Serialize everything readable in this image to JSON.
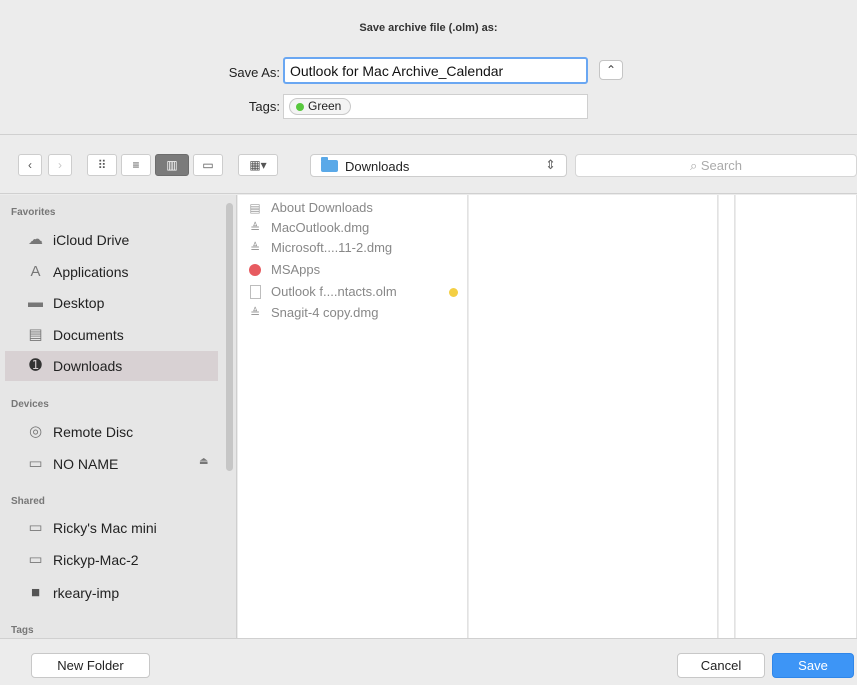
{
  "dialog": {
    "prompt": "Save archive file (.olm) as:",
    "save_as_label": "Save As:",
    "save_as_value": "Outlook for Mac Archive_Calendar",
    "tags_label": "Tags:",
    "tag": {
      "name": "Green",
      "color": "#58c83e"
    }
  },
  "toolbar": {
    "back_icon": "chevron-left-icon",
    "forward_icon": "chevron-right-icon",
    "views": [
      "icon-view",
      "list-view",
      "column-view",
      "cover-flow-view"
    ],
    "selected_view": "column-view",
    "arrange_icon": "arrange-icon",
    "location": "Downloads",
    "search_placeholder": "Search"
  },
  "sidebar": {
    "favorites_header": "Favorites",
    "favorites": [
      {
        "label": "iCloud Drive",
        "icon": "cloud-icon"
      },
      {
        "label": "Applications",
        "icon": "applications-icon"
      },
      {
        "label": "Desktop",
        "icon": "desktop-icon"
      },
      {
        "label": "Documents",
        "icon": "documents-icon"
      },
      {
        "label": "Downloads",
        "icon": "downloads-icon",
        "selected": true
      }
    ],
    "devices_header": "Devices",
    "devices": [
      {
        "label": "Remote Disc",
        "icon": "disc-icon"
      },
      {
        "label": "NO NAME",
        "icon": "drive-icon",
        "eject": "⏏"
      }
    ],
    "shared_header": "Shared",
    "shared": [
      {
        "label": "Ricky's Mac mini",
        "icon": "network-computer-icon"
      },
      {
        "label": "Rickyp-Mac-2",
        "icon": "network-computer-icon"
      },
      {
        "label": "rkeary-imp",
        "icon": "display-icon"
      }
    ],
    "tags_header": "Tags"
  },
  "files": [
    {
      "name": "About Downloads",
      "icon": "document-icon"
    },
    {
      "name": "MacOutlook.dmg",
      "icon": "disk-image-icon"
    },
    {
      "name": "Microsoft....11-2.dmg",
      "icon": "disk-image-icon"
    },
    {
      "name": "MSApps",
      "icon": "app-folder-icon",
      "color": "#e75b60"
    },
    {
      "name": "Outlook f....ntacts.olm",
      "icon": "blank-document-icon",
      "tag_color": "#f4cf44"
    },
    {
      "name": "Snagit-4 copy.dmg",
      "icon": "disk-image-icon"
    }
  ],
  "buttons": {
    "new_folder": "New Folder",
    "cancel": "Cancel",
    "save": "Save"
  }
}
